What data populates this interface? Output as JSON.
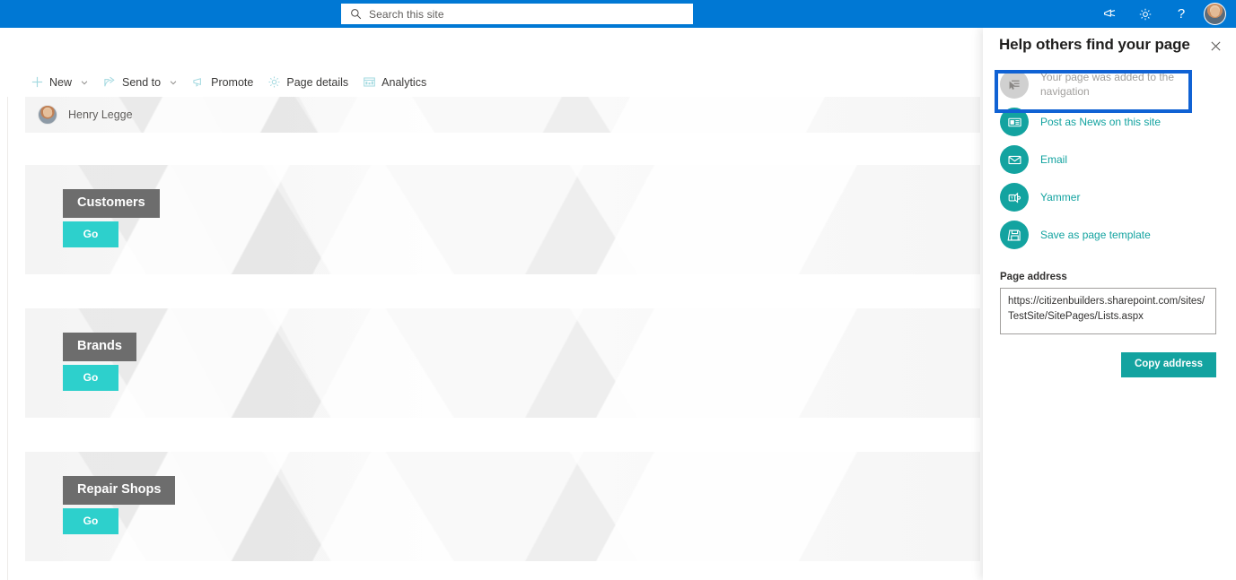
{
  "suite": {
    "search": {
      "placeholder": "Search this site",
      "icon": "search-icon"
    },
    "actions": [
      {
        "name": "megaphone-icon",
        "glyph": "megaphone"
      },
      {
        "name": "gear-icon",
        "glyph": "gear"
      },
      {
        "name": "help-icon",
        "glyph": "?"
      }
    ],
    "avatar": "user-avatar",
    "brand_color": "#0078d4"
  },
  "command_bar": {
    "items": [
      {
        "label": "New",
        "icon": "plus-icon",
        "caret": true
      },
      {
        "label": "Send to",
        "icon": "send-to-icon",
        "caret": true
      },
      {
        "label": "Promote",
        "icon": "promote-megaphone-icon",
        "caret": false
      },
      {
        "label": "Page details",
        "icon": "gear-icon",
        "caret": false
      },
      {
        "label": "Analytics",
        "icon": "analytics-icon",
        "caret": false
      }
    ]
  },
  "page": {
    "byline": {
      "author": "Henry Legge"
    },
    "cards": [
      {
        "title": "Customers",
        "button": "Go"
      },
      {
        "title": "Brands",
        "button": "Go"
      },
      {
        "title": "Repair Shops",
        "button": "Go"
      }
    ],
    "card_title_bg": "#6d6d6d",
    "card_button_bg": "#2dd0cc"
  },
  "panel": {
    "title": "Help others find your page",
    "close": "✕",
    "accent_color": "#13a3a0",
    "focus_color": "#1062d4",
    "items": [
      {
        "label": "Your page was added to the navigation",
        "icon": "navigation-added-icon",
        "disabled": true,
        "focused": true
      },
      {
        "label": "Post as News on this site",
        "icon": "news-icon",
        "disabled": false,
        "focused": false
      },
      {
        "label": "Email",
        "icon": "email-icon",
        "disabled": false,
        "focused": false
      },
      {
        "label": "Yammer",
        "icon": "yammer-icon",
        "disabled": false,
        "focused": false
      },
      {
        "label": "Save as page template",
        "icon": "save-icon",
        "disabled": false,
        "focused": false
      }
    ],
    "address": {
      "label": "Page address",
      "value": "https://citizenbuilders.sharepoint.com/sites/TestSite/SitePages/Lists.aspx"
    },
    "copy_button": "Copy address"
  }
}
